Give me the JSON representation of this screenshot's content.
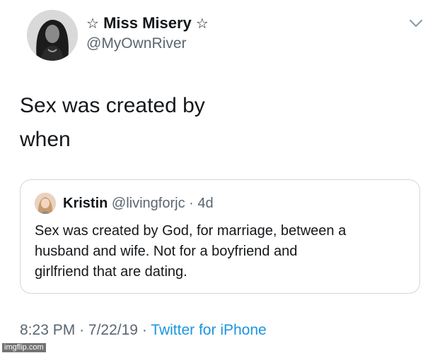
{
  "tweet": {
    "author": {
      "star_left": "☆",
      "name": "Miss Misery",
      "star_right": "☆",
      "handle": "@MyOwnRiver",
      "avatar_icon": "profile-photo"
    },
    "menu_icon": "chevron-down-icon",
    "text_lines": [
      "Sex was created by",
      "when"
    ],
    "quoted": {
      "name": "Kristin",
      "handle": "@livingforjc",
      "separator": "·",
      "time": "4d",
      "text_lines": [
        "Sex was created by God, for marriage, between a",
        "husband and wife. Not for a boyfriend and",
        "girlfriend that are dating."
      ]
    },
    "footer": {
      "time": "8:23 PM",
      "sep1": "·",
      "date": "7/22/19",
      "sep2": "·",
      "source": "Twitter for iPhone"
    }
  },
  "watermark": "imgflip.com",
  "colors": {
    "text": "#14171a",
    "secondary": "#5b6670",
    "link": "#1b95e0",
    "border": "#d0d7dc"
  }
}
